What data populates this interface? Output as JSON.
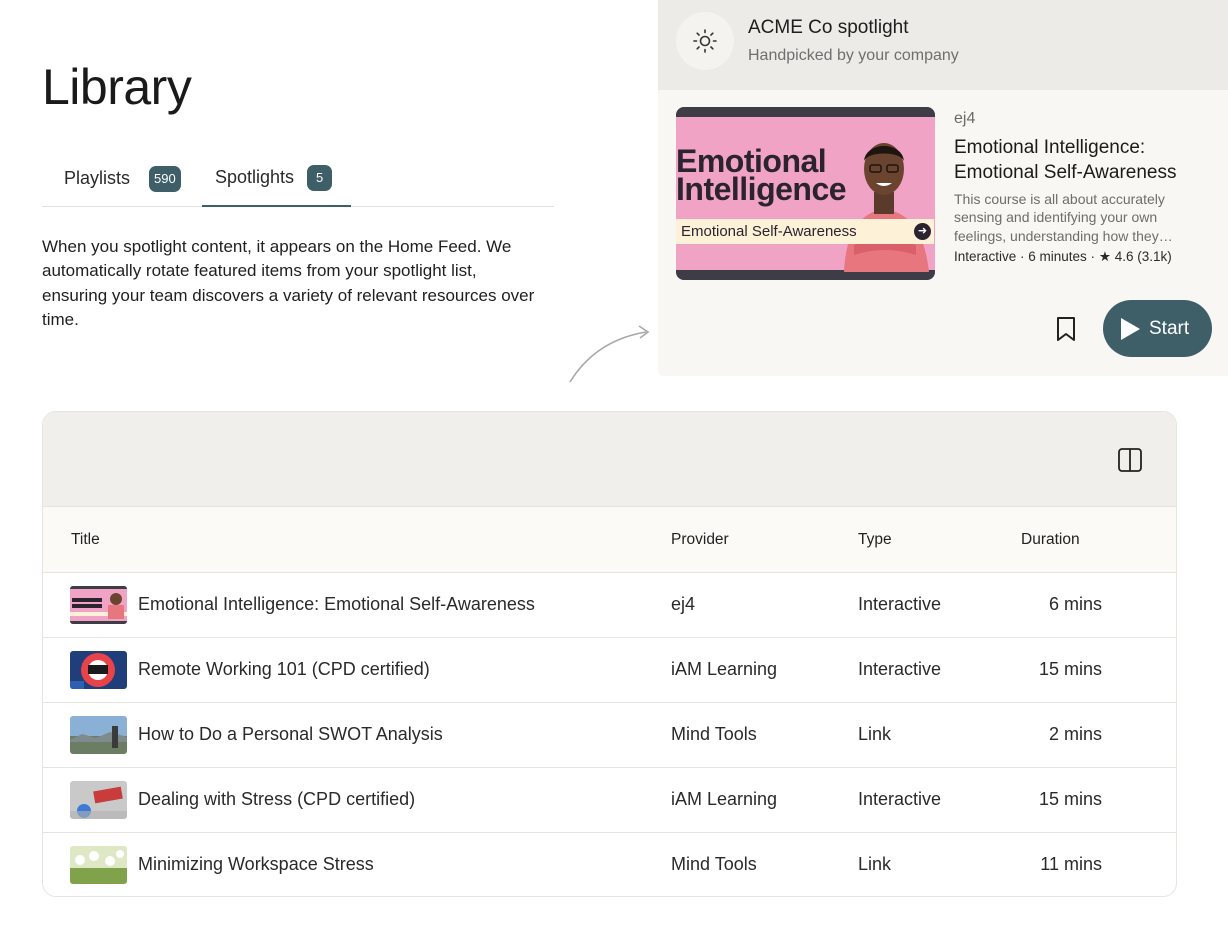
{
  "page": {
    "title": "Library"
  },
  "tabs": [
    {
      "label": "Playlists",
      "count": "590"
    },
    {
      "label": "Spotlights",
      "count": "5"
    }
  ],
  "intro_text": "When you spotlight content, it appears on the Home Feed. We automatically rotate featured items from your spotlight list, ensuring your team discovers a variety of relevant resources over time.",
  "spotlight": {
    "title": "ACME Co spotlight",
    "subtitle": "Handpicked by your company",
    "thumb_title": "Emotional Intelligence",
    "thumb_subtitle": "Emotional Self-Awareness",
    "provider": "ej4",
    "course_title": "Emotional Intelligence: Emotional Self-Awareness",
    "description": "This course is all about accurately sensing and identifying your own feelings, understanding how they…",
    "meta": "Interactive · 6 minutes · ",
    "rating": "4.6 (3.1k)",
    "start_label": "Start"
  },
  "table": {
    "headers": {
      "title": "Title",
      "provider": "Provider",
      "type": "Type",
      "duration": "Duration"
    },
    "rows": [
      {
        "title": "Emotional Intelligence: Emotional Self-Awareness",
        "provider": "ej4",
        "type": "Interactive",
        "duration": "6 mins"
      },
      {
        "title": "Remote Working 101 (CPD certified)",
        "provider": "iAM Learning",
        "type": "Interactive",
        "duration": "15 mins"
      },
      {
        "title": "How to Do a Personal SWOT Analysis",
        "provider": "Mind Tools",
        "type": "Link",
        "duration": "2 mins"
      },
      {
        "title": "Dealing with Stress (CPD certified)",
        "provider": "iAM Learning",
        "type": "Interactive",
        "duration": "15 mins"
      },
      {
        "title": "Minimizing Workspace Stress",
        "provider": "Mind Tools",
        "type": "Link",
        "duration": "11 mins"
      }
    ]
  },
  "colors": {
    "accent": "#3e5e68",
    "panel": "#f8f7f3",
    "toolbar": "#f0efeb"
  },
  "icons": {
    "spotlight": "sun-icon",
    "bookmark": "bookmark-icon",
    "start": "play-icon",
    "columns": "columns-toggle-icon"
  }
}
